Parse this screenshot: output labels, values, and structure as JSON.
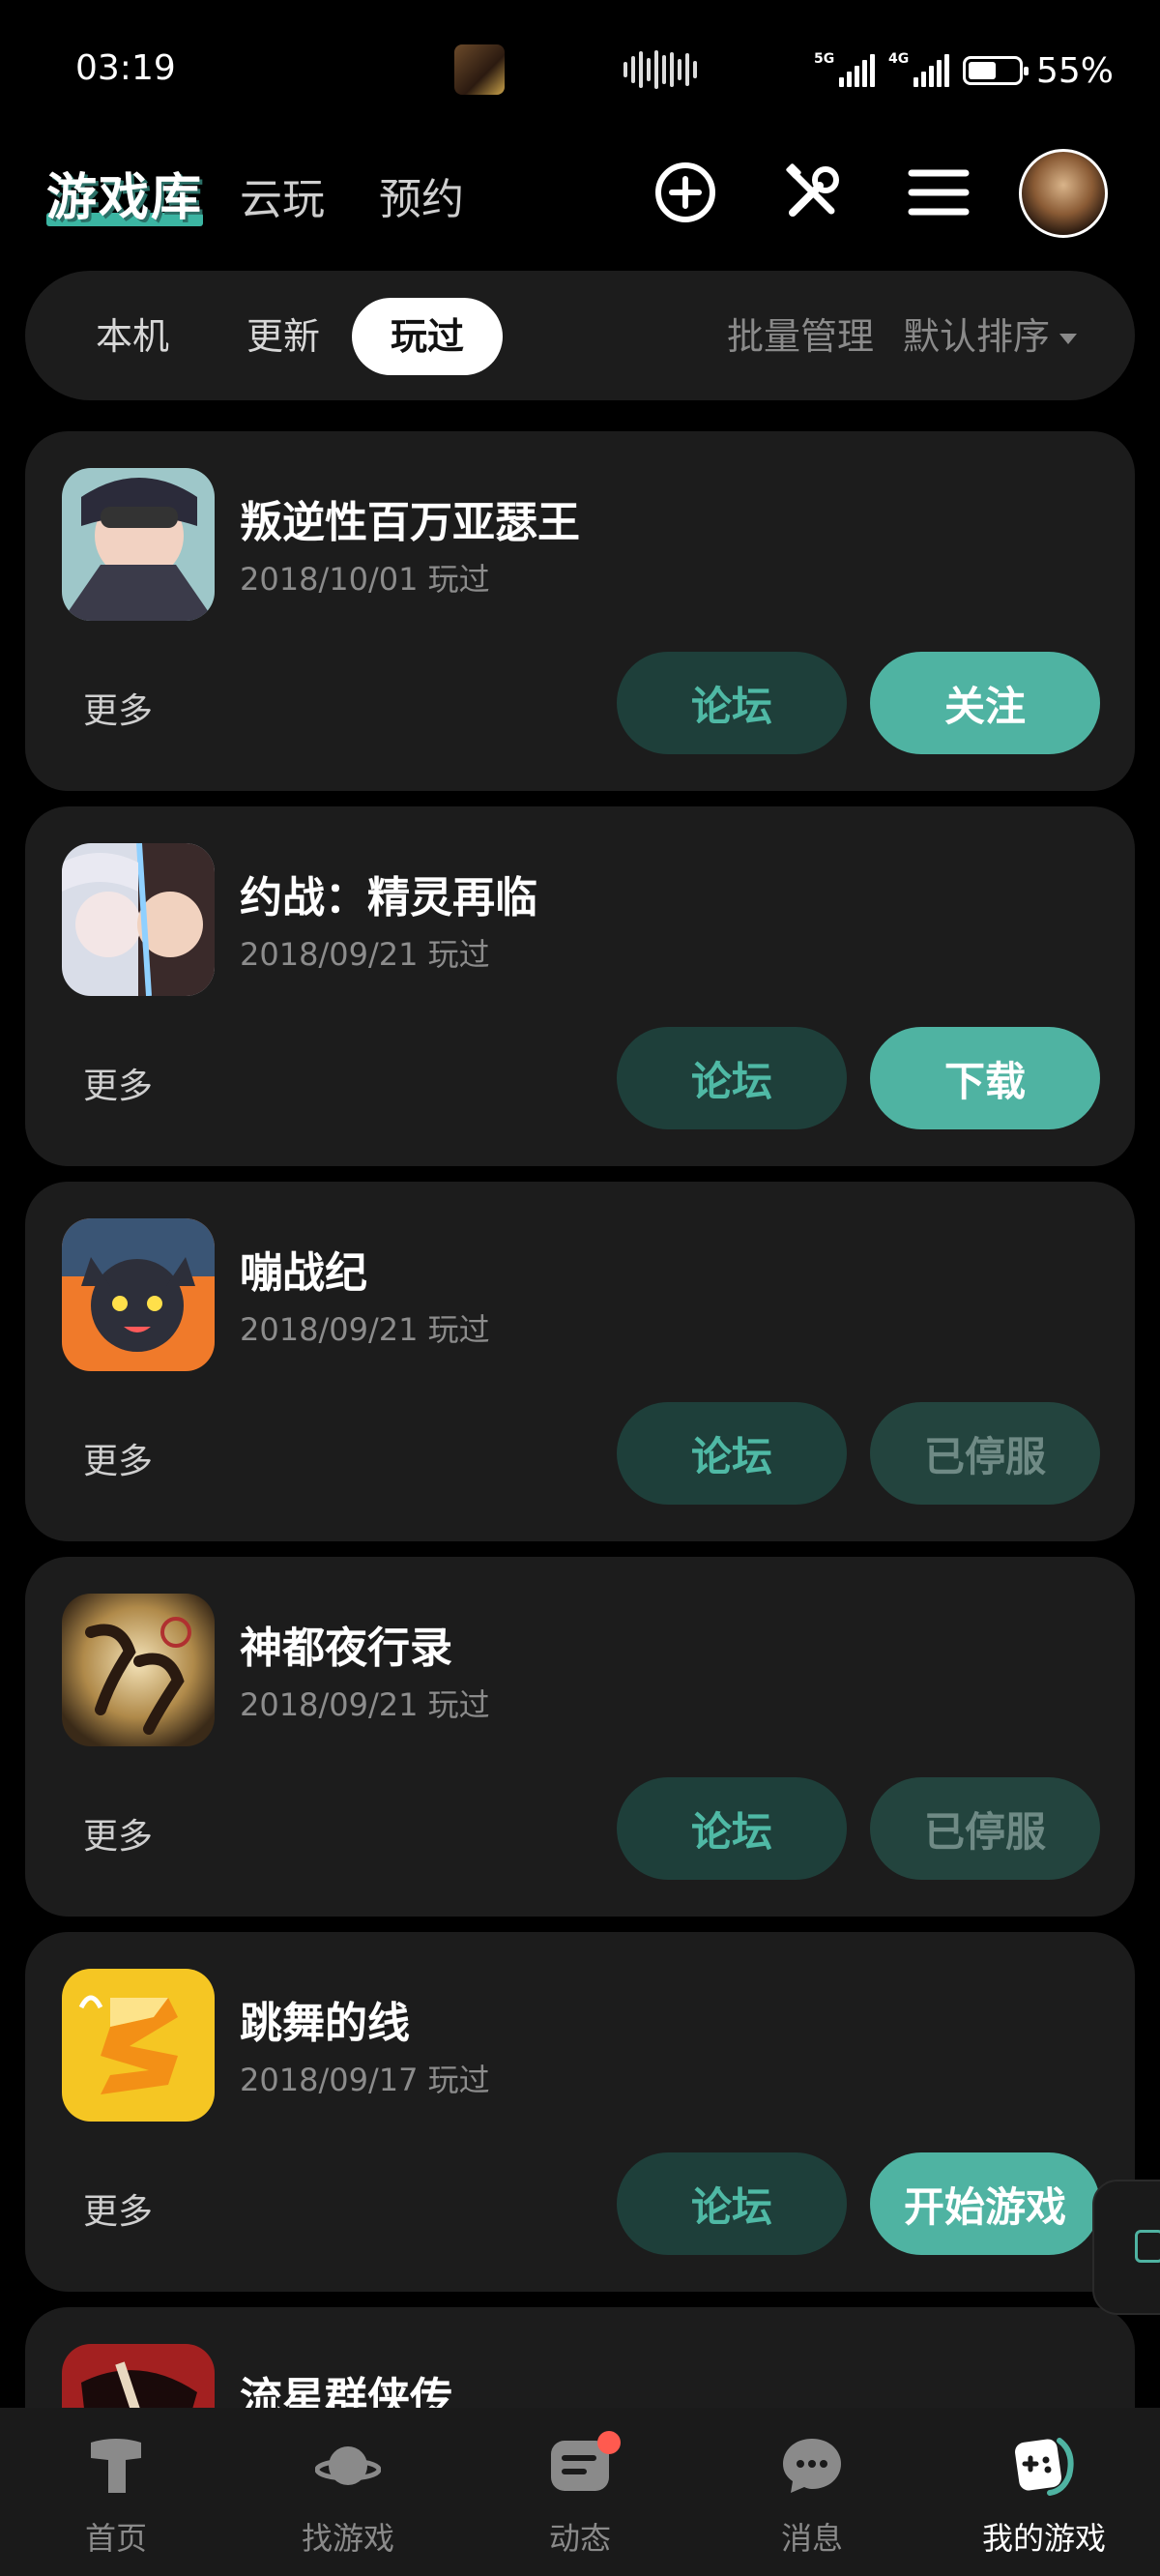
{
  "status_bar": {
    "time": "03:19",
    "network_1": "5G",
    "network_2": "4G",
    "battery_percent": "55%",
    "battery_level": 0.55
  },
  "header": {
    "logo": "游戏库",
    "tabs": [
      "云玩",
      "预约"
    ],
    "icons": [
      "add-circle-icon",
      "tools-icon",
      "menu-icon"
    ],
    "avatar": "avatar"
  },
  "filter": {
    "tabs": [
      "本机",
      "更新",
      "玩过"
    ],
    "active_tab": "玩过",
    "batch_manage": "批量管理",
    "sort": "默认排序"
  },
  "games": [
    {
      "name": "叛逆性百万亚瑟王",
      "date": "2018/10/01 玩过",
      "more": "更多",
      "forum": "论坛",
      "action": "关注",
      "action_state": "primary"
    },
    {
      "name": "约战：精灵再临",
      "date": "2018/09/21 玩过",
      "more": "更多",
      "forum": "论坛",
      "action": "下载",
      "action_state": "primary"
    },
    {
      "name": "嘣战纪",
      "date": "2018/09/21 玩过",
      "more": "更多",
      "forum": "论坛",
      "action": "已停服",
      "action_state": "disabled"
    },
    {
      "name": "神都夜行录",
      "date": "2018/09/21 玩过",
      "more": "更多",
      "forum": "论坛",
      "action": "已停服",
      "action_state": "disabled"
    },
    {
      "name": "跳舞的线",
      "date": "2018/09/17 玩过",
      "more": "更多",
      "forum": "论坛",
      "action": "开始游戏",
      "action_state": "primary"
    },
    {
      "name": "流星群侠传"
    }
  ],
  "bottom_nav": [
    {
      "label": "首页",
      "icon": "home-icon"
    },
    {
      "label": "找游戏",
      "icon": "planet-icon"
    },
    {
      "label": "动态",
      "icon": "feed-icon"
    },
    {
      "label": "消息",
      "icon": "chat-icon"
    },
    {
      "label": "我的游戏",
      "icon": "gamepad-icon",
      "active": true
    }
  ],
  "colors": {
    "accent": "#4fb3a2",
    "forum_bg": "#1e3f3a",
    "card_bg": "#1c1c1c",
    "badge": "#ff5a4f"
  }
}
